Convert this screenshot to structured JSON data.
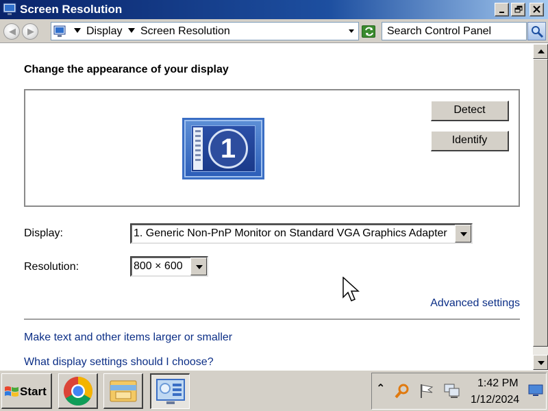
{
  "window": {
    "title": "Screen Resolution",
    "caption_icon": "display-settings-icon",
    "caption_buttons": [
      "minimize-icon",
      "restore-icon",
      "close-icon"
    ]
  },
  "address_bar": {
    "breadcrumbs": [
      "Display",
      "Screen Resolution"
    ],
    "search_placeholder": "Search Control Panel",
    "refresh_icon": "refresh-icon",
    "search_icon": "search-icon"
  },
  "content": {
    "heading": "Change the appearance of your display",
    "monitor_number": "1",
    "buttons": {
      "detect": "Detect",
      "identify": "Identify"
    },
    "display_label": "Display:",
    "display_value": "1. Generic Non-PnP Monitor on Standard VGA Graphics Adapter",
    "resolution_label": "Resolution:",
    "resolution_value": "800 × 600",
    "advanced_link": "Advanced settings",
    "links": [
      "Make text and other items larger or smaller",
      "What display settings should I choose?"
    ]
  },
  "taskbar": {
    "start_label": "Start",
    "items": [
      "chrome-icon",
      "file-explorer-icon",
      "display-settings-icon"
    ],
    "tray_icons": [
      "show-hidden-icon",
      "search-icon",
      "action-center-flag-icon",
      "network-icon",
      "show-desktop-icon"
    ],
    "time": "1:42 PM",
    "date": "1/12/2024"
  },
  "colors": {
    "titlebar_start": "#0a246a",
    "link": "#0b2e86",
    "face": "#d4d0c8"
  }
}
